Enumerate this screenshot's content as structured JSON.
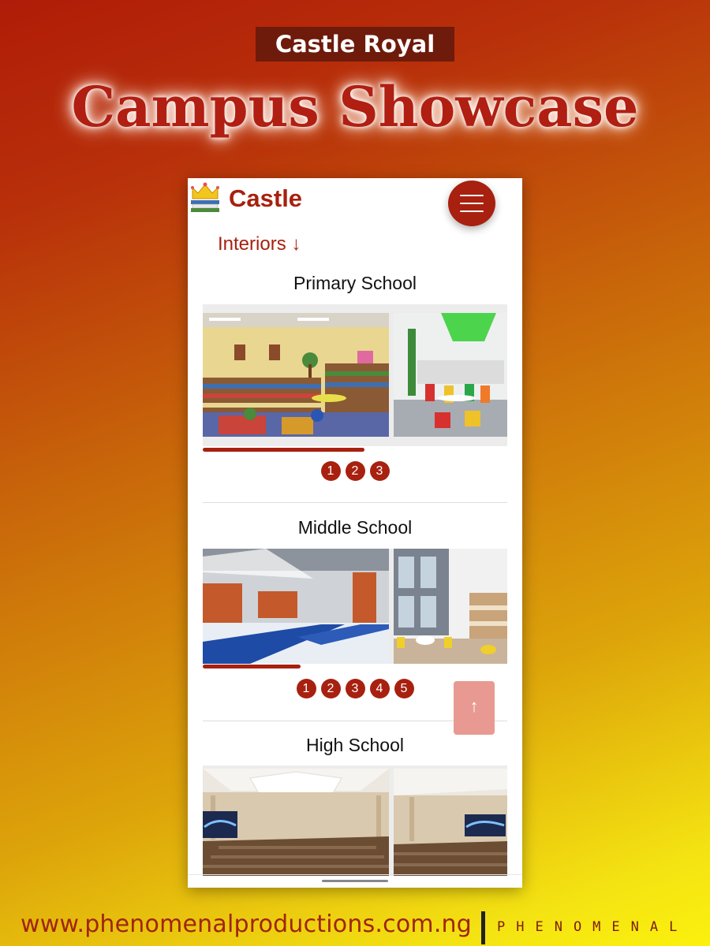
{
  "header": {
    "badge": "Castle Royal",
    "title": "Campus Showcase"
  },
  "phone": {
    "logo_text": "Castle",
    "interiors_label": "Interiors ↓",
    "sections": [
      {
        "title": "Primary School",
        "pages": [
          "1",
          "2",
          "3"
        ],
        "progress": 0.53
      },
      {
        "title": "Middle School",
        "pages": [
          "1",
          "2",
          "3",
          "4",
          "5"
        ],
        "progress": 0.32
      },
      {
        "title": "High School"
      }
    ],
    "scroll_top_glyph": "↑"
  },
  "footer": {
    "url": "www.phenomenalproductions.com.ng",
    "brand": "PHENOMENAL"
  },
  "colors": {
    "accent": "#a8200f",
    "badge_bg": "#6e1b0b",
    "scroll_top": "#e89a92"
  },
  "icons": [
    "crown-logo-icon",
    "menu-icon",
    "arrow-up-icon"
  ]
}
